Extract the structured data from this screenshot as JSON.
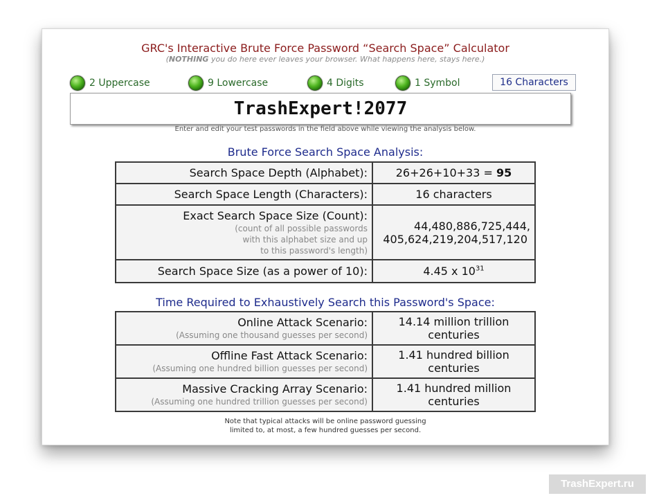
{
  "header": {
    "title": "GRC's Interactive Brute Force Password “Search Space” Calculator",
    "subtitle_prefix": "(",
    "subtitle_bold": "NOTHING",
    "subtitle_rest": " you do here ever leaves your browser. What happens here, stays here.)"
  },
  "indicators": [
    {
      "label": "2 Uppercase"
    },
    {
      "label": "9 Lowercase"
    },
    {
      "label": "4 Digits"
    },
    {
      "label": "1 Symbol"
    }
  ],
  "char_count": "16 Characters",
  "password": {
    "value": "TrashExpert!2077"
  },
  "hint": "Enter and edit your test passwords in the field above while viewing the analysis below.",
  "analysis": {
    "title": "Brute Force Search Space Analysis:",
    "depth_label": "Search Space Depth (Alphabet):",
    "depth_expr": "26+26+10+33 = ",
    "depth_total": "95",
    "length_label": "Search Space Length (Characters):",
    "length_value": "16 characters",
    "exact_label": "Exact Search Space Size (Count):",
    "exact_note_1": "(count of all possible passwords",
    "exact_note_2": "with this alphabet size and up",
    "exact_note_3": "to this password's length)",
    "exact_value_1": "44,480,886,725,444,",
    "exact_value_2": "405,624,219,204,517,120",
    "power_label": "Search Space Size (as a power of 10):",
    "power_base": "4.45 x 10",
    "power_exp": "31"
  },
  "time": {
    "title": "Time Required to Exhaustively Search this Password's Space:",
    "rows": [
      {
        "label": "Online Attack Scenario:",
        "note": "(Assuming one thousand guesses per second)",
        "value_1": "14.14 million trillion",
        "value_2": "centuries"
      },
      {
        "label": "Offline Fast Attack Scenario:",
        "note": "(Assuming one hundred billion guesses per second)",
        "value_1": "1.41 hundred billion",
        "value_2": "centuries"
      },
      {
        "label": "Massive Cracking Array Scenario:",
        "note": "(Assuming one hundred trillion guesses per second)",
        "value_1": "1.41 hundred million",
        "value_2": "centuries"
      }
    ]
  },
  "footnote": {
    "line_1": "Note that typical attacks will be online password guessing",
    "line_2": "limited to, at most, a few hundred guesses per second."
  },
  "watermark": "TrashExpert.ru"
}
